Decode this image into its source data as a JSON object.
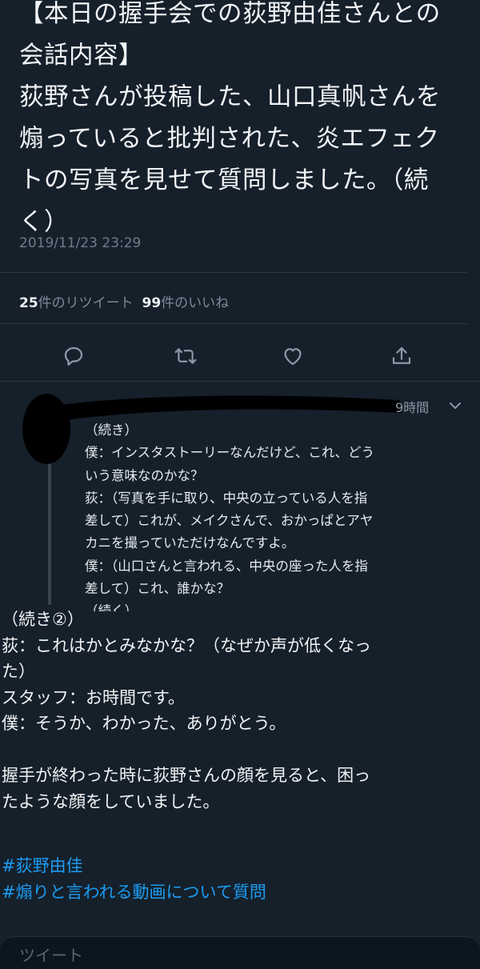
{
  "tweet": {
    "text_lines": [
      "【本日の握手会での荻野由佳さんとの",
      "会話内容】",
      "荻野さんが投稿した、山口真帆さんを",
      "煽っていると批判された、炎エフェク",
      "トの写真を見せて質問しました。（続",
      "く）"
    ],
    "timestamp": "2019/11/23 23:29",
    "retweet_count": "25",
    "retweet_label": "件のリツイート",
    "like_count": "99",
    "like_label": "件のいいね"
  },
  "actions": {
    "reply_icon": "reply-icon",
    "retweet_icon": "retweet-icon",
    "like_icon": "heart-icon",
    "share_icon": "share-icon"
  },
  "reply": {
    "time": "9時間",
    "lines": [
      "（続き）",
      "僕：インスタストーリーなんだけど、これ、どう",
      "いう意味なのかな？",
      "荻：（写真を手に取り、中央の立っている人を指",
      "差して）これが、メイクさんで、おかっぱとアヤ",
      "カニを撮っていただけなんですよ。",
      "僕：（山口さんと言われる、中央の座った人を指",
      "差して）これ、誰かな？",
      "（続く）"
    ]
  },
  "main": {
    "lines": [
      "（続き②）",
      "荻：これはかとみなかな？（なぜか声が低くなっ",
      "た）",
      "スタッフ：お時間です。",
      "僕：そうか、わかった、ありがとう。",
      "",
      "握手が終わった時に荻野さんの顔を見ると、困っ",
      "たような顔をしていました。",
      ""
    ],
    "hashtags": [
      "#荻野由佳",
      "#煽りと言われる動画について質問"
    ]
  },
  "compose": {
    "label": "ツイート"
  },
  "colors": {
    "background": "#15202b",
    "link": "#1d9bf0",
    "muted": "#8899a6"
  }
}
